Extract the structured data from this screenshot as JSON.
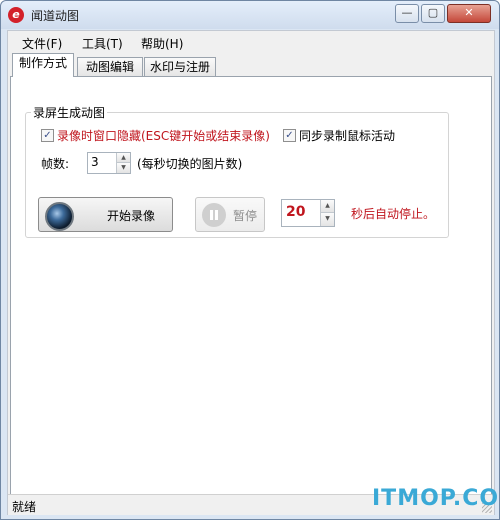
{
  "window": {
    "title": "闻道动图"
  },
  "menu": [
    "文件(F)",
    "工具(T)",
    "帮助(H)"
  ],
  "tabs": [
    "制作方式",
    "动图编辑",
    "水印与注册"
  ],
  "group": {
    "title": "录屏生成动图"
  },
  "options": {
    "hide_window": {
      "label": "录像时窗口隐藏(ESC键开始或结束录像)",
      "checked": true
    },
    "sync_mouse": {
      "label": "同步录制鼠标活动",
      "checked": true
    }
  },
  "frames": {
    "label": "帧数:",
    "value": "3",
    "hint": "(每秒切换的图片数)"
  },
  "buttons": {
    "start_label": "开始录像",
    "pause_label": "暂停"
  },
  "auto_stop": {
    "value": "20",
    "suffix": "秒后自动停止。"
  },
  "status": {
    "text": "就绪"
  },
  "watermark": "ITMOP.COM",
  "icons": {
    "app": "app-logo-icon",
    "checkmark": "✓"
  },
  "colors": {
    "accent_red": "#c0161e",
    "watermark": "#3aa9d6"
  }
}
